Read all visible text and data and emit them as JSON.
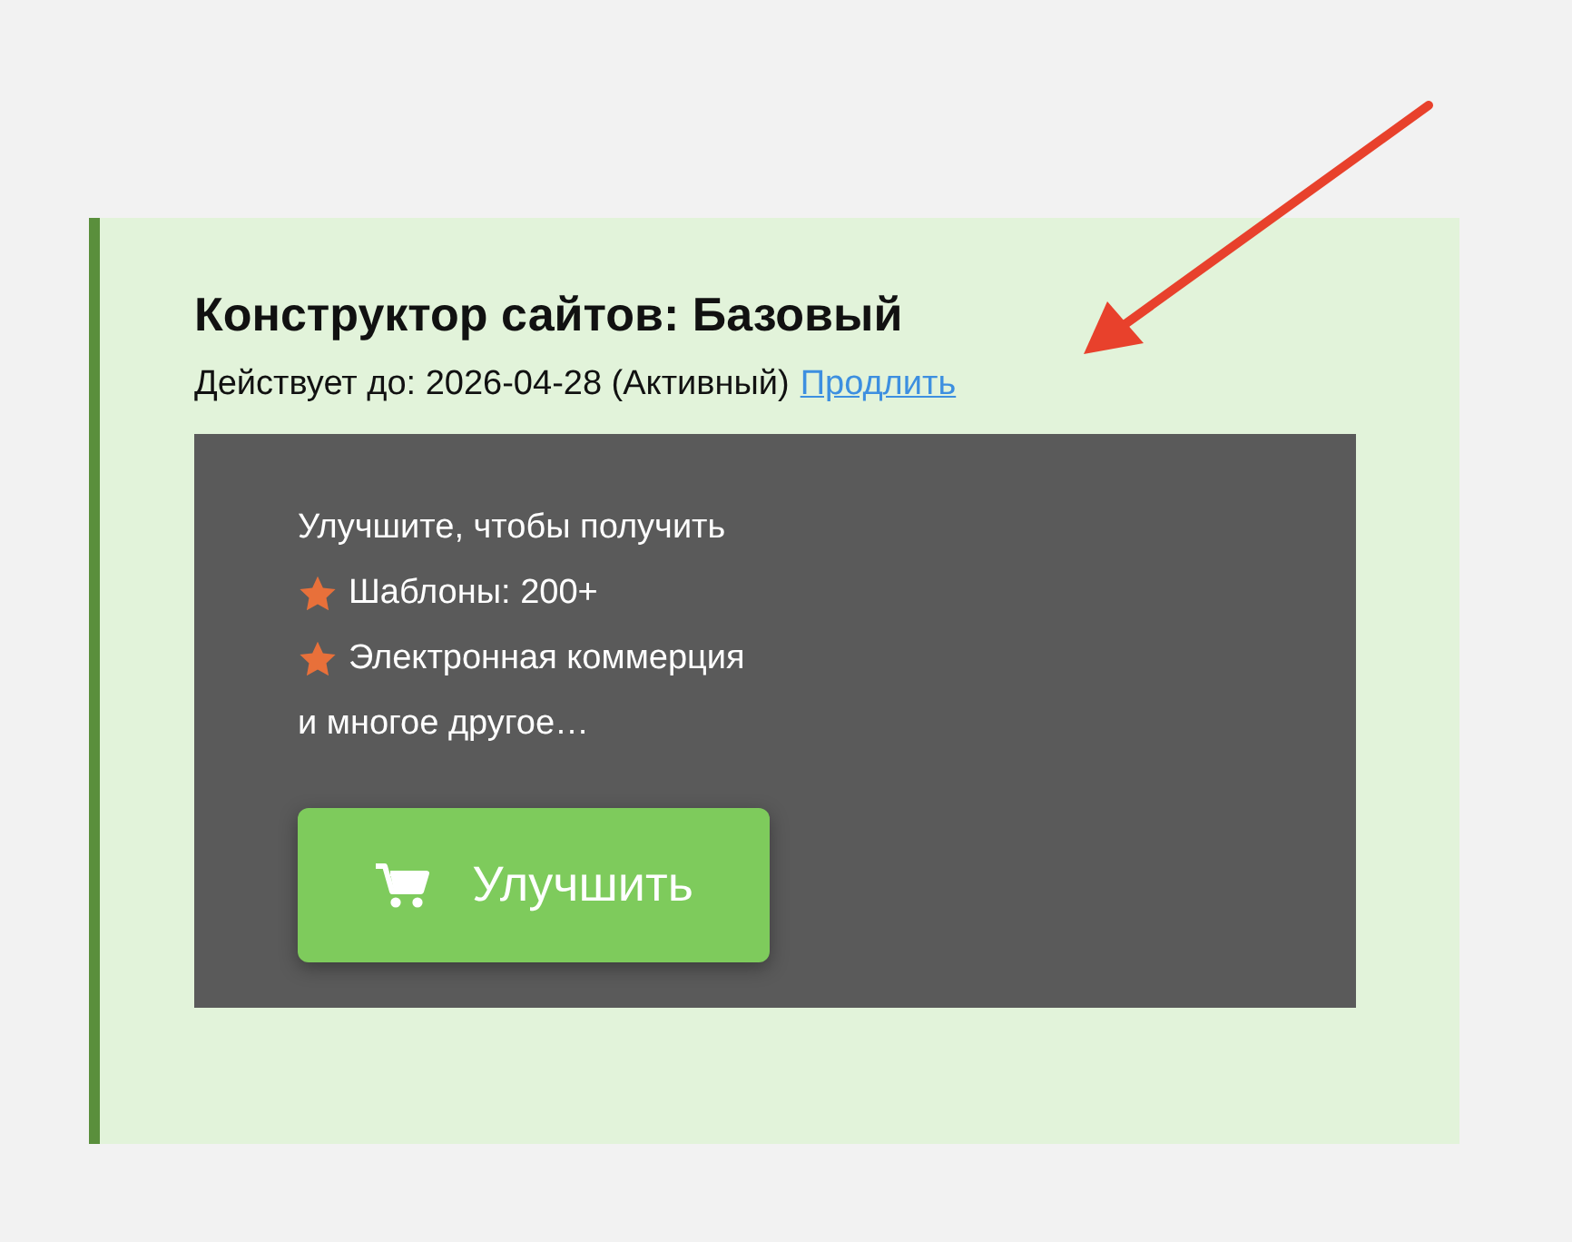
{
  "card": {
    "title": "Конструктор сайтов: Базовый",
    "validity": "Действует до: 2026-04-28 (Активный)",
    "renew_link": "Продлить",
    "promo": {
      "lines": [
        {
          "kind": "text",
          "text": "Улучшите, чтобы получить"
        },
        {
          "kind": "feature",
          "text": "Шаблоны: 200+"
        },
        {
          "kind": "feature",
          "text": "Электронная коммерция"
        },
        {
          "kind": "text",
          "text": "и многое другое…"
        }
      ],
      "button": "Улучшить"
    }
  }
}
